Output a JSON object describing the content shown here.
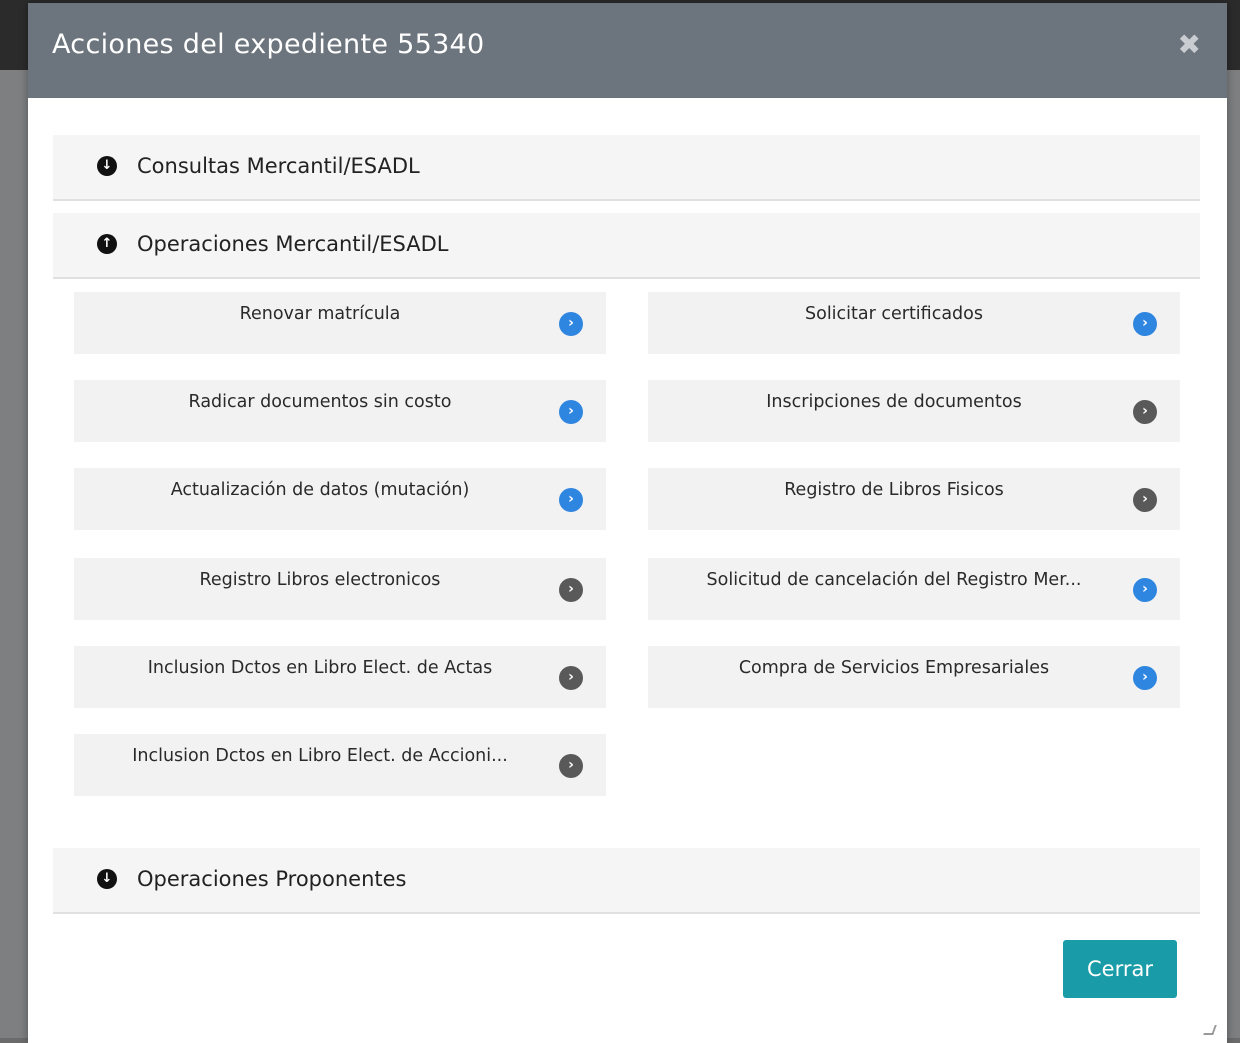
{
  "modal": {
    "title": "Acciones del expediente 55340",
    "close_icon": "✖"
  },
  "sections": [
    {
      "label": "Consultas Mercantil/ESADL",
      "state": "collapsed",
      "icon": "arrow-down-circle-icon"
    },
    {
      "label": "Operaciones Mercantil/ESADL",
      "state": "expanded",
      "icon": "arrow-up-circle-icon"
    },
    {
      "label": "Operaciones Proponentes",
      "state": "collapsed",
      "icon": "arrow-down-circle-icon"
    }
  ],
  "section_glyphs": {
    "down": "↓",
    "up": "↑"
  },
  "operations": [
    {
      "label": "Renovar matrícula",
      "arrow_color": "#2f86e0"
    },
    {
      "label": "Solicitar certificados",
      "arrow_color": "#2f86e0"
    },
    {
      "label": "Radicar documentos sin costo",
      "arrow_color": "#2f86e0"
    },
    {
      "label": "Inscripciones de documentos",
      "arrow_color": "#595959"
    },
    {
      "label": "Actualización de datos (mutación)",
      "arrow_color": "#2f86e0"
    },
    {
      "label": "Registro de Libros Fisicos",
      "arrow_color": "#595959"
    },
    {
      "label": "Registro Libros electronicos",
      "arrow_color": "#595959"
    },
    {
      "label": "Solicitud de cancelación del Registro Mer...",
      "arrow_color": "#2f86e0"
    },
    {
      "label": "Inclusion Dctos en Libro Elect. de Actas",
      "arrow_color": "#595959"
    },
    {
      "label": "Compra de Servicios Empresariales",
      "arrow_color": "#2f86e0"
    },
    {
      "label": "Inclusion Dctos en Libro Elect. de Accioni...",
      "arrow_color": "#595959"
    }
  ],
  "arrow_glyph": "›",
  "footer": {
    "close_button_label": "Cerrar"
  }
}
